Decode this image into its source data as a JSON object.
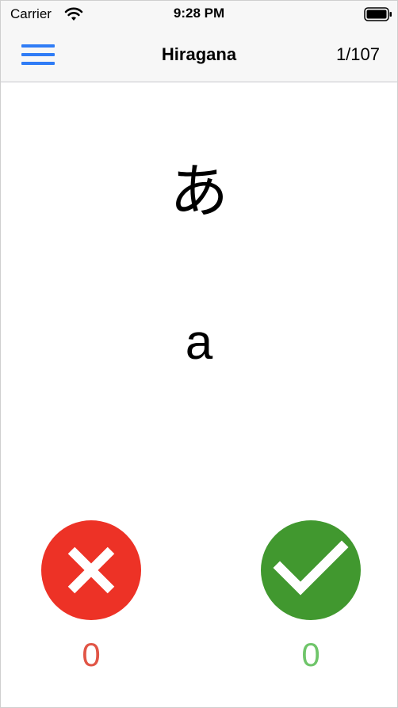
{
  "status_bar": {
    "carrier": "Carrier",
    "time": "9:28 PM"
  },
  "nav": {
    "title": "Hiragana",
    "counter": "1/107",
    "menu_icon": "hamburger-menu-icon"
  },
  "card": {
    "kana": "あ",
    "romaji": "a"
  },
  "answers": {
    "wrong": {
      "icon": "x-icon",
      "count": "0",
      "color": "#ed3226"
    },
    "right": {
      "icon": "checkmark-icon",
      "count": "0",
      "color": "#41982f"
    }
  },
  "colors": {
    "accent": "#2f7cf6",
    "wrong_score": "#e15546",
    "right_score": "#6fc56a"
  }
}
